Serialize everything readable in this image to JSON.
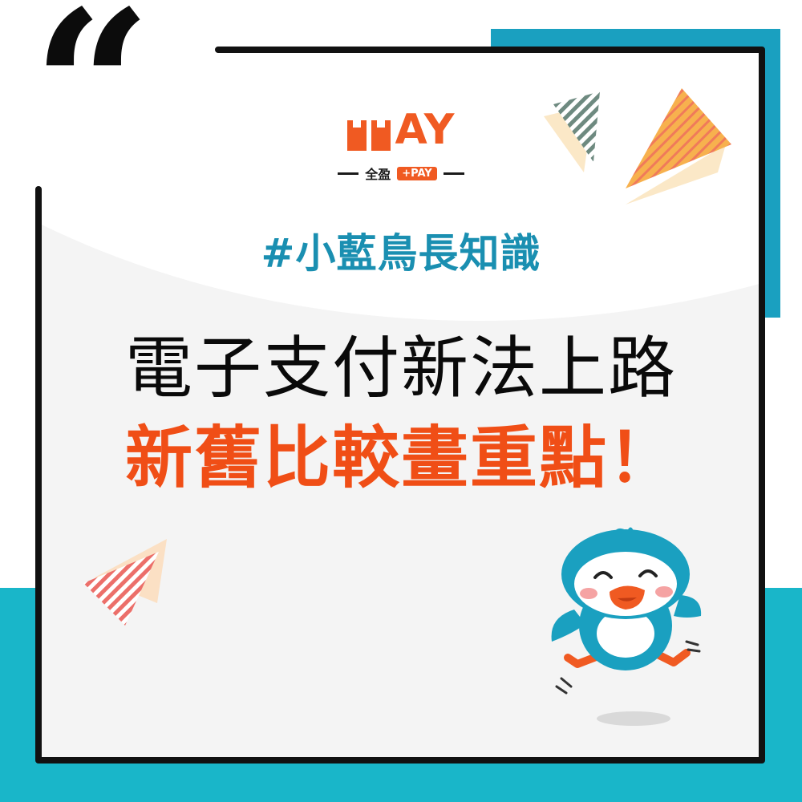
{
  "brand": {
    "logo_word": "AY",
    "logo_sub_text": "全盈",
    "logo_pill_text": "+PAY"
  },
  "hashtag": "#小藍鳥長知識",
  "headline": "電子支付新法上路",
  "subline": "新舊比較畫重點！",
  "quote_mark": "“",
  "colors": {
    "teal_dark": "#1aa0c0",
    "teal_light": "#19b6c9",
    "brand_orange": "#f05a22",
    "text_black": "#0a0a0a",
    "hashtag_blue": "#1a8fb1"
  },
  "icons": {
    "quote": "quote-mark-icon",
    "mascot": "blue-bird-mascot-icon"
  }
}
